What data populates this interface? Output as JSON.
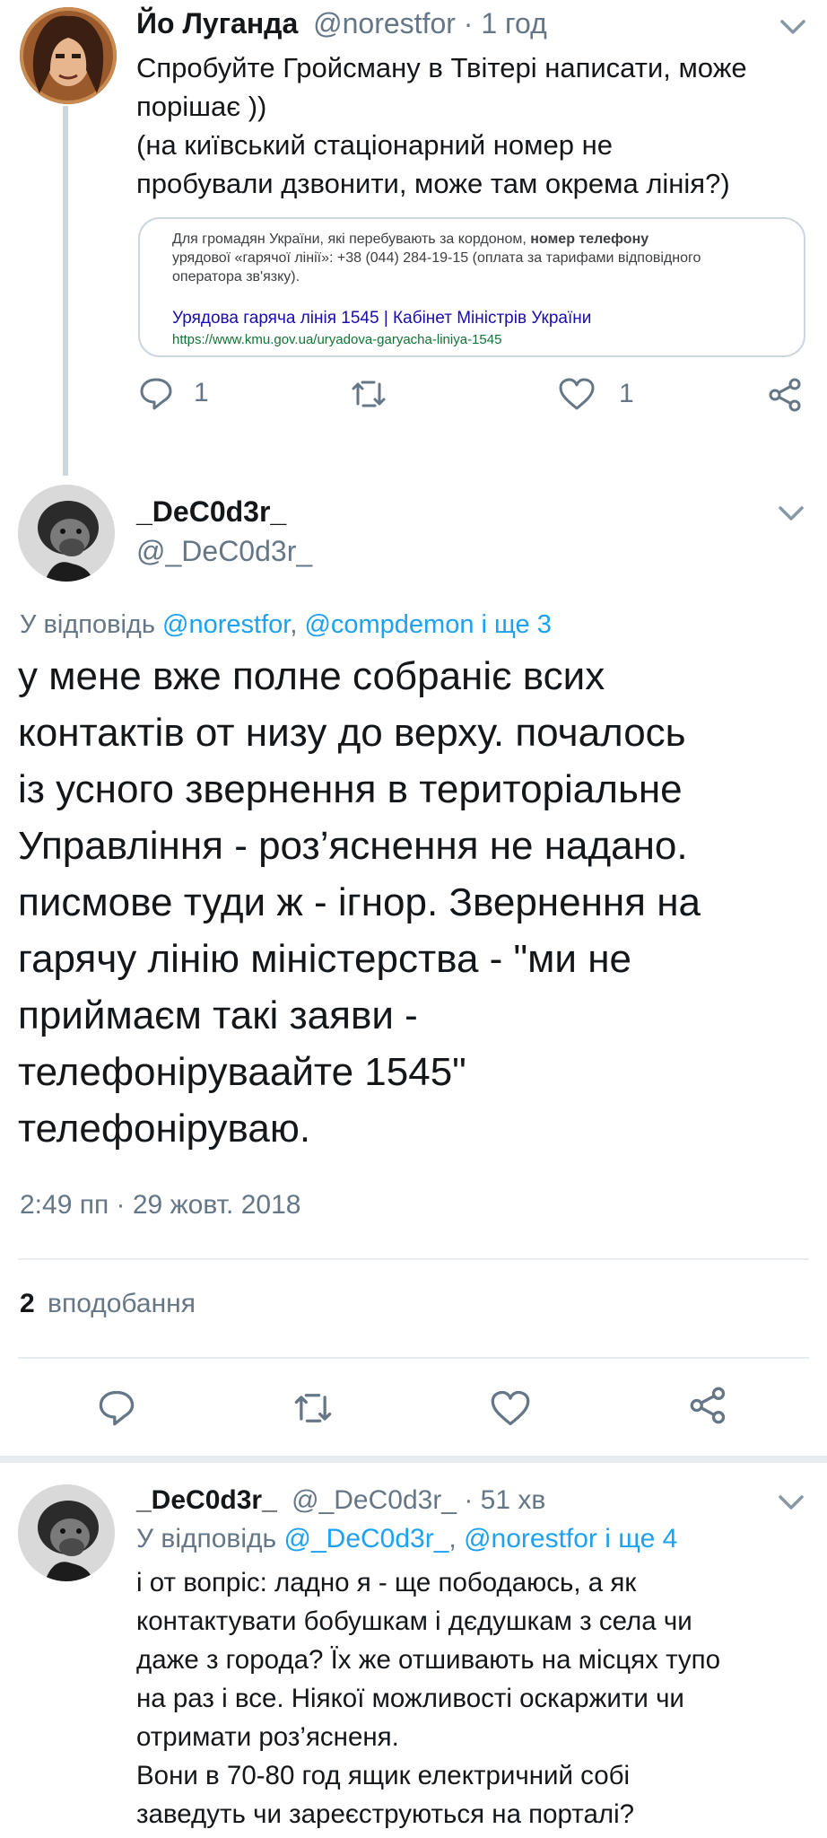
{
  "tweet1": {
    "author_name": "Йо Луганда",
    "author_handle": "@norestfor",
    "time": "1 год",
    "text_lines": [
      "Спробуйте Гройсману в Твітері написати, може",
      "порішає ))",
      "(на київський стаціонарний номер не",
      "пробували дзвонити, може там окрема лінія?)"
    ],
    "card": {
      "snippet_line1_pre": "Для громадян України, які перебувають за кордоном, ",
      "snippet_line1_bold": "номер телефону",
      "snippet_line2": "урядової «гарячої лінії»: +38 (044) 284-19-15 (оплата за тарифами відповідного",
      "snippet_line3": "оператора зв'язку).",
      "title": "Урядова гаряча лінія 1545 | Кабінет Міністрів України",
      "url": "https://www.kmu.gov.ua/uryadova-garyacha-liniya-1545"
    },
    "reply_count": "1",
    "like_count": "1"
  },
  "tweet2": {
    "author_name": "_DeC0d3r_",
    "author_handle": "@_DeC0d3r_",
    "reply_prefix": "У відповідь ",
    "reply_mention1": "@norestfor",
    "reply_sep": ", ",
    "reply_mention2": "@compdemon",
    "reply_more": " і ще 3",
    "text_lines": [
      "у мене вже полне собраніє всих",
      "контактів от низу до верху. почалось",
      "із усного звернення в територіальне",
      "Управління - роз’яснення не надано.",
      "писмове туди ж - ігнор. Звернення на",
      "гарячу лінію міністерства - \"ми не",
      "приймаєм такі заяви -",
      "телефоніруваайте 1545\"",
      "телефоніруваю."
    ],
    "timestamp": "2:49 пп · 29 жовт. 2018",
    "likes_count": "2",
    "likes_label": "вподобання"
  },
  "tweet3": {
    "author_name": "_DeC0d3r_",
    "author_handle": "@_DeC0d3r_",
    "time": "51 хв",
    "reply_prefix": "У відповідь ",
    "reply_mention1": "@_DeC0d3r_",
    "reply_sep": ", ",
    "reply_mention2": "@norestfor",
    "reply_more": " і ще 4",
    "text_lines": [
      "і от вопріс: ладно я - ще пободаюсь, а як",
      "контактувати бобушкам і дєдушкам з села чи",
      "даже з города? Їх же отшивають на місцях тупо",
      "на раз і все. Ніякої можливості оскаржити чи",
      "отримати роз’ясненя.",
      "Вони в 70-80 год ящик електричний собі",
      "заведуть чи зареєструються на порталі?"
    ]
  },
  "icons": [
    "reply-icon",
    "retweet-icon",
    "like-icon",
    "share-icon",
    "chevron-down-icon"
  ],
  "colors": {
    "link": "#1da1f2",
    "muted": "#657786",
    "text": "#14171a",
    "divider": "#e6ecf0"
  }
}
